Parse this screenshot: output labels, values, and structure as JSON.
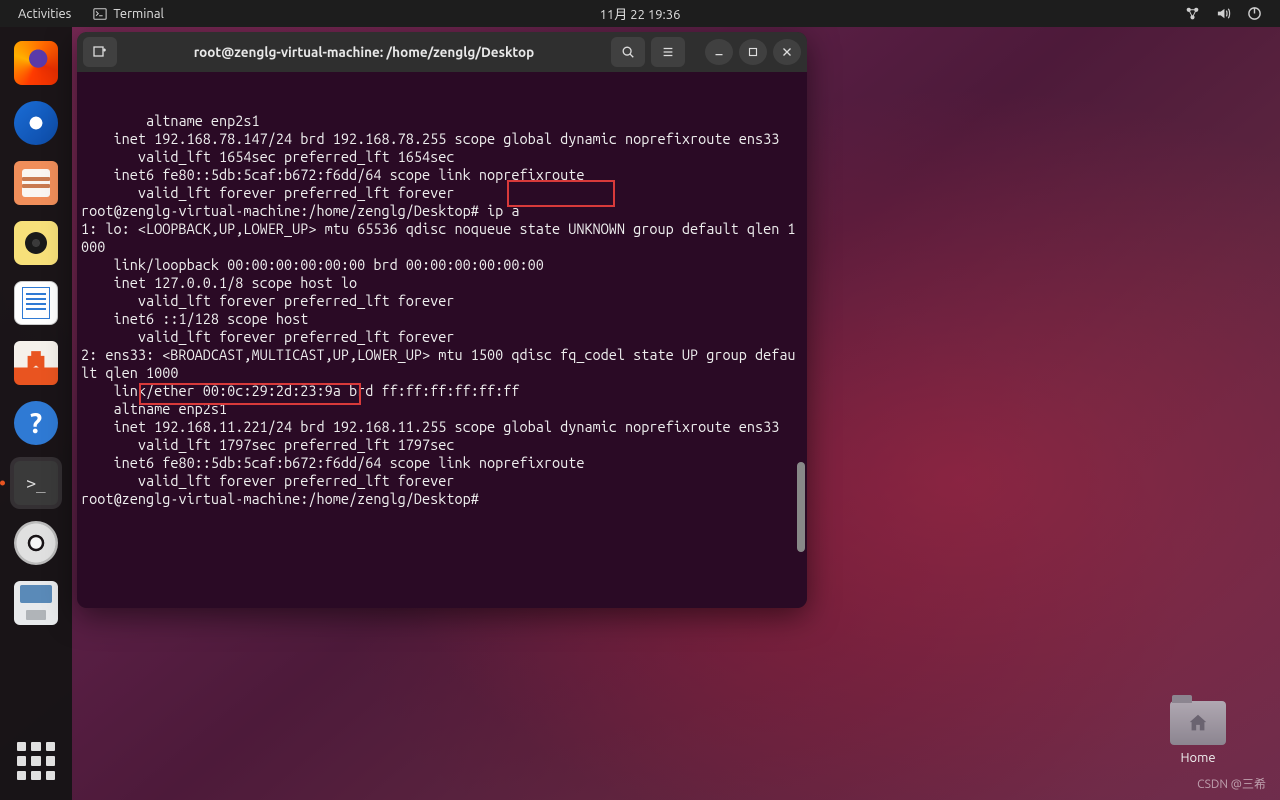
{
  "topbar": {
    "activities": "Activities",
    "app_label": "Terminal",
    "clock": "11月 22  19:36"
  },
  "dock": {
    "items": [
      {
        "name": "firefox-icon"
      },
      {
        "name": "thunderbird-icon"
      },
      {
        "name": "files-icon"
      },
      {
        "name": "rhythmbox-icon"
      },
      {
        "name": "writer-icon"
      },
      {
        "name": "software-icon"
      },
      {
        "name": "help-icon"
      },
      {
        "name": "terminal-icon",
        "active": true
      },
      {
        "name": "disc-icon"
      },
      {
        "name": "disk-util-icon"
      }
    ]
  },
  "terminal": {
    "title": "root@zenglg-virtual-machine: /home/zenglg/Desktop",
    "lines": [
      "        altname enp2s1",
      "    inet 192.168.78.147/24 brd 192.168.78.255 scope global dynamic noprefixroute ens33",
      "       valid_lft 1654sec preferred_lft 1654sec",
      "    inet6 fe80::5db:5caf:b672:f6dd/64 scope link noprefixroute",
      "       valid_lft forever preferred_lft forever",
      "root@zenglg-virtual-machine:/home/zenglg/Desktop# ip a",
      "1: lo: <LOOPBACK,UP,LOWER_UP> mtu 65536 qdisc noqueue state UNKNOWN group default qlen 1000",
      "    link/loopback 00:00:00:00:00:00 brd 00:00:00:00:00:00",
      "    inet 127.0.0.1/8 scope host lo",
      "       valid_lft forever preferred_lft forever",
      "    inet6 ::1/128 scope host",
      "       valid_lft forever preferred_lft forever",
      "2: ens33: <BROADCAST,MULTICAST,UP,LOWER_UP> mtu 1500 qdisc fq_codel state UP group default qlen 1000",
      "    link/ether 00:0c:29:2d:23:9a brd ff:ff:ff:ff:ff:ff",
      "    altname enp2s1",
      "    inet 192.168.11.221/24 brd 192.168.11.255 scope global dynamic noprefixroute ens33",
      "       valid_lft 1797sec preferred_lft 1797sec",
      "    inet6 fe80::5db:5caf:b672:f6dd/64 scope link noprefixroute",
      "       valid_lft forever preferred_lft forever",
      "root@zenglg-virtual-machine:/home/zenglg/Desktop#"
    ],
    "command_highlight": " ip a"
  },
  "desktop": {
    "home_label": "Home"
  },
  "watermark": "CSDN @三希"
}
